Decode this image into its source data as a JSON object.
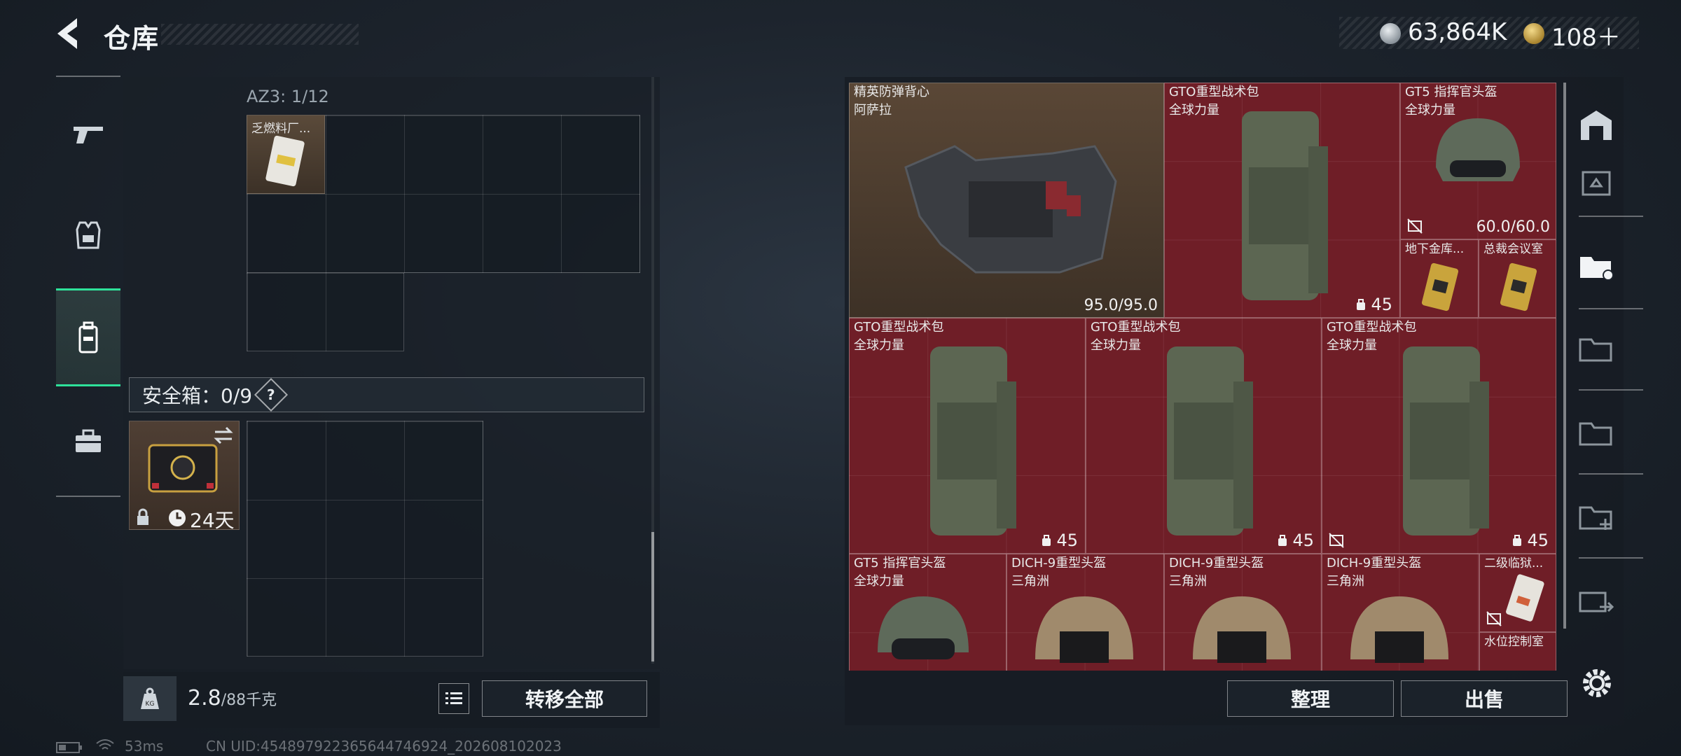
{
  "header": {
    "title": "仓库"
  },
  "currency": {
    "silver": "63,864K",
    "gold": "108＋"
  },
  "left_nav": [
    "weapons-tab",
    "gear-tab",
    "backpack-tab",
    "case-tab"
  ],
  "container": {
    "title": "AZ3: 1/12",
    "items": [
      {
        "name": "乏燃料厂..."
      }
    ]
  },
  "safe": {
    "header": "安全箱：0/9",
    "help": "?",
    "days": "24天"
  },
  "weight": {
    "current": "2.8",
    "max": "/88千克"
  },
  "buttons": {
    "transfer_all": "转移全部",
    "sort": "整理",
    "sell": "出售"
  },
  "stash": {
    "armor": {
      "name": "精英防弹背心",
      "sub": "阿萨拉",
      "durability": "95.0/95.0"
    },
    "bag1": {
      "name": "GTO重型战术包",
      "sub": "全球力量",
      "count": "45"
    },
    "helmet1": {
      "name": "GT5 指挥官头盔",
      "sub": "全球力量",
      "durability": "60.0/60.0"
    },
    "key1": {
      "name": "地下金库..."
    },
    "key2": {
      "name": "总裁会议室"
    },
    "bag2": {
      "name": "GTO重型战术包",
      "sub": "全球力量",
      "count": "45"
    },
    "bag3": {
      "name": "GTO重型战术包",
      "sub": "全球力量",
      "count": "45"
    },
    "bag4": {
      "name": "GTO重型战术包",
      "sub": "全球力量",
      "count": "45"
    },
    "helmet2": {
      "name": "GT5 指挥官头盔",
      "sub": "全球力量"
    },
    "helmet3": {
      "name": "DICH-9重型头盔",
      "sub": "三角洲"
    },
    "helmet4": {
      "name": "DICH-9重型头盔",
      "sub": "三角洲"
    },
    "helmet5": {
      "name": "DICH-9重型头盔",
      "sub": "三角洲"
    },
    "card1": {
      "name": "二级临狱..."
    },
    "card2": {
      "name": "水位控制室"
    }
  },
  "footer": {
    "ping": "53ms",
    "uid": "CN UID:4548979223656447469​24_202608102023"
  },
  "colors": {
    "accent_green": "#2ee29a",
    "item_red": "#6b1f27"
  }
}
